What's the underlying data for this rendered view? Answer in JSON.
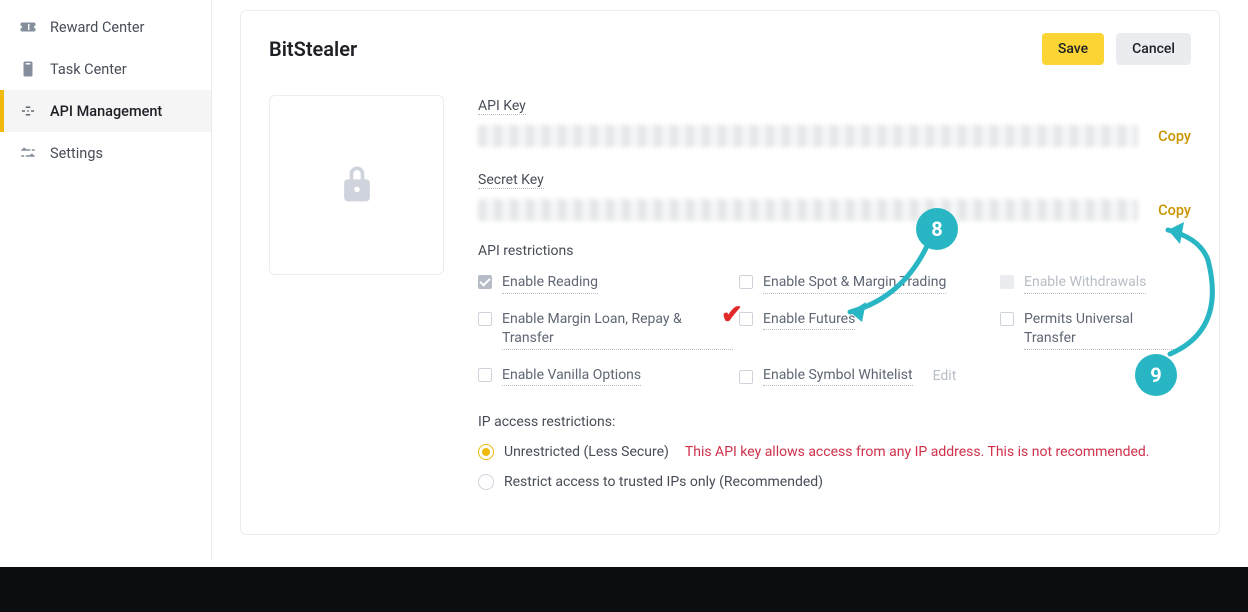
{
  "sidebar": {
    "items": [
      {
        "label": "Reward Center",
        "icon": "ticket-icon"
      },
      {
        "label": "Task Center",
        "icon": "clipboard-icon"
      },
      {
        "label": "API Management",
        "icon": "api-icon"
      },
      {
        "label": "Settings",
        "icon": "sliders-icon"
      }
    ]
  },
  "header": {
    "title": "BitStealer",
    "save_label": "Save",
    "cancel_label": "Cancel"
  },
  "fields": {
    "api_key_label": "API Key",
    "secret_key_label": "Secret Key",
    "copy_label": "Copy"
  },
  "restrictions": {
    "title": "API restrictions",
    "items": [
      {
        "label": "Enable Reading",
        "checked": true,
        "locked": true
      },
      {
        "label": "Enable Spot & Margin Trading",
        "checked": false
      },
      {
        "label": "Enable Withdrawals",
        "checked": false,
        "locked": true
      },
      {
        "label": "Enable Margin Loan, Repay & Transfer",
        "checked": false
      },
      {
        "label": "Enable Futures",
        "checked": false
      },
      {
        "label": "Permits Universal Transfer",
        "checked": false
      },
      {
        "label": "Enable Vanilla Options",
        "checked": false
      },
      {
        "label": "Enable Symbol Whitelist",
        "checked": false,
        "edit": "Edit"
      }
    ]
  },
  "ip": {
    "title": "IP access restrictions:",
    "option1": "Unrestricted (Less Secure)",
    "warning": "This API key allows access from any IP address. This is not recommended.",
    "option2": "Restrict access to trusted IPs only (Recommended)"
  },
  "annotations": {
    "step8": "8",
    "step9": "9"
  }
}
